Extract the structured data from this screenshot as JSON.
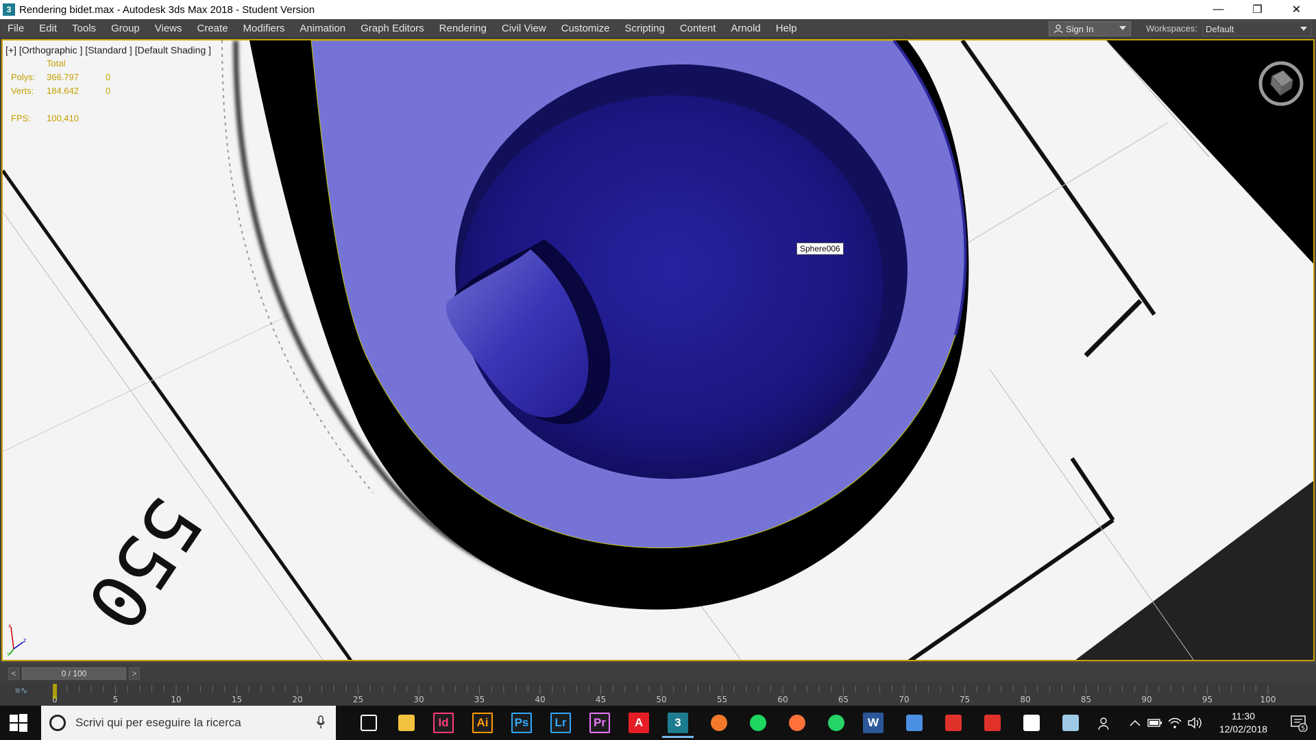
{
  "window": {
    "title": "Rendering bidet.max - Autodesk 3ds Max 2018 - Student Version",
    "app_icon": "3",
    "minimize": "—",
    "restore": "❐",
    "close": "✕"
  },
  "menu": {
    "items": [
      "File",
      "Edit",
      "Tools",
      "Group",
      "Views",
      "Create",
      "Modifiers",
      "Animation",
      "Graph Editors",
      "Rendering",
      "Civil View",
      "Customize",
      "Scripting",
      "Content",
      "Arnold",
      "Help"
    ],
    "sign_in": "Sign In",
    "workspaces_label": "Workspaces:",
    "workspace_value": "Default"
  },
  "viewport": {
    "label": "[+] [Orthographic ] [Standard ] [Default Shading ]",
    "stats": {
      "total_header": "Total",
      "polys_label": "Polys:",
      "polys_total": "366.797",
      "polys_sel": "0",
      "verts_label": "Verts:",
      "verts_total": "184.642",
      "verts_sel": "0",
      "fps_label": "FPS:",
      "fps_value": "100,410"
    },
    "object_tooltip": "Sphere006",
    "blueprint_text": "550",
    "colors": {
      "object_light": "#7574d6",
      "object_dark": "#1a1680",
      "stats_text": "#c4a000",
      "background": "#f4f4f4"
    }
  },
  "timeline": {
    "prev": "<",
    "next": ">",
    "frame_display": "0 / 100",
    "ticks": [
      "0",
      "5",
      "10",
      "15",
      "20",
      "25",
      "30",
      "35",
      "40",
      "45",
      "50",
      "55",
      "60",
      "65",
      "70",
      "75",
      "80",
      "85",
      "90",
      "95",
      "100"
    ],
    "curve_btn": "≡∿"
  },
  "taskbar": {
    "search_placeholder": "Scrivi qui per eseguire la ricerca",
    "apps": [
      {
        "name": "task-view",
        "label": "",
        "color": "#ffffff"
      },
      {
        "name": "file-explorer",
        "label": "",
        "color": "#f3c23f"
      },
      {
        "name": "indesign",
        "label": "Id",
        "color": "#ff3c80"
      },
      {
        "name": "illustrator",
        "label": "Ai",
        "color": "#ff9a00"
      },
      {
        "name": "photoshop",
        "label": "Ps",
        "color": "#31a8ff"
      },
      {
        "name": "lightroom",
        "label": "Lr",
        "color": "#31a8ff"
      },
      {
        "name": "premiere",
        "label": "Pr",
        "color": "#ea77ff"
      },
      {
        "name": "autocad",
        "label": "A",
        "color": "#e51e25"
      },
      {
        "name": "3dsmax",
        "label": "3",
        "color": "#1d9aa8"
      },
      {
        "name": "blender",
        "label": "",
        "color": "#f5792a"
      },
      {
        "name": "spotify",
        "label": "",
        "color": "#1ed760"
      },
      {
        "name": "firefox",
        "label": "",
        "color": "#ff7139"
      },
      {
        "name": "whatsapp",
        "label": "",
        "color": "#25d366"
      },
      {
        "name": "word",
        "label": "W",
        "color": "#2b579a"
      },
      {
        "name": "store",
        "label": "",
        "color": "#4a90e2"
      },
      {
        "name": "sketchup",
        "label": "",
        "color": "#e0322b"
      },
      {
        "name": "acrobat",
        "label": "",
        "color": "#e0322b"
      },
      {
        "name": "photos",
        "label": "",
        "color": "#ffffff"
      },
      {
        "name": "paint",
        "label": "",
        "color": "#9ec9e6"
      }
    ],
    "clock_time": "11:30",
    "clock_date": "12/02/2018",
    "notification_count": "5"
  }
}
